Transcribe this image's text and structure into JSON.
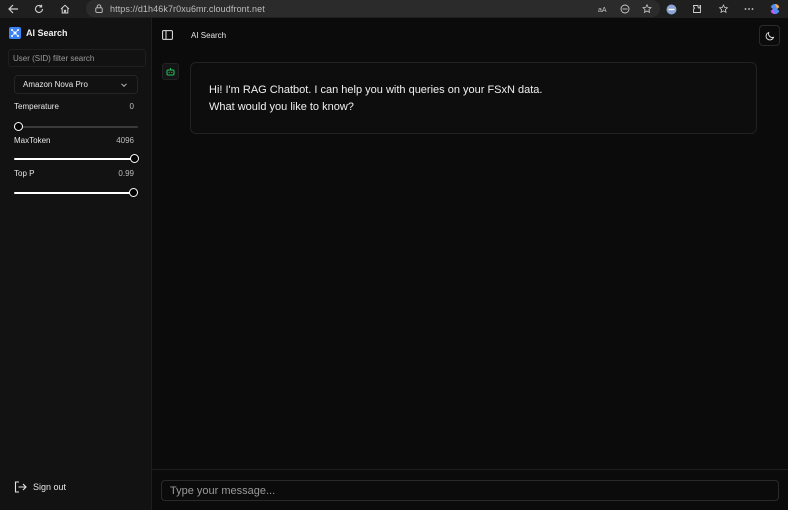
{
  "browser": {
    "url": "https://d1h46k7r0xu6mr.cloudfront.net"
  },
  "sidebar": {
    "brand": "AI Search",
    "filter_placeholder": "User (SID) filter search",
    "model": "Amazon Nova Pro",
    "params": [
      {
        "label": "Temperature",
        "value": "0",
        "level": 0
      },
      {
        "label": "MaxToken",
        "value": "4096",
        "level": 1.0
      },
      {
        "label": "Top P",
        "value": "0.99",
        "level": 0.99
      }
    ],
    "signout": "Sign out"
  },
  "main": {
    "title": "AI Search",
    "message_line1": "Hi! I'm RAG Chatbot. I can help you with queries on your FSxN data.",
    "message_line2": "What would you like to know?",
    "composer_placeholder": "Type your message..."
  },
  "colors": {
    "background": "#0b0b0c",
    "sidebar": "#121212",
    "accent_bot": "#22c55e",
    "brand_blue": "#3b82f6"
  }
}
